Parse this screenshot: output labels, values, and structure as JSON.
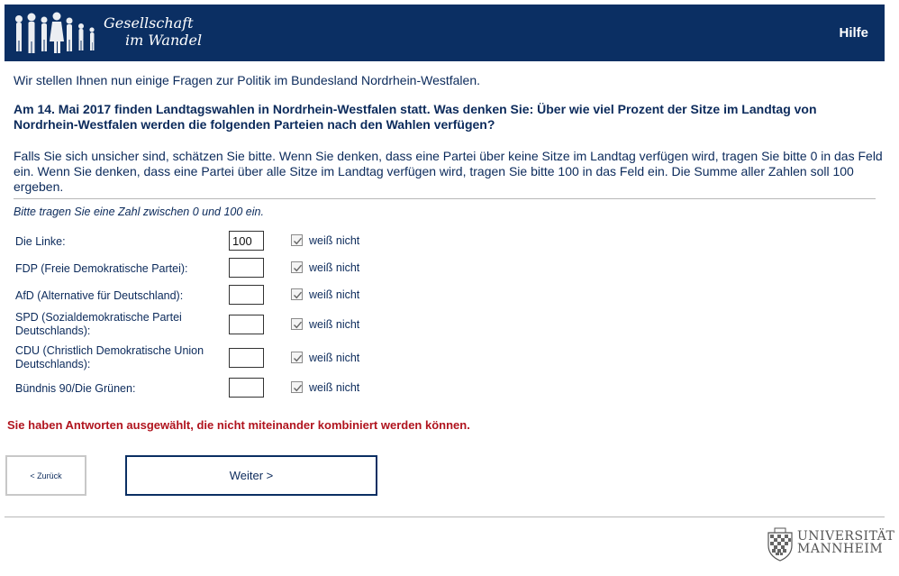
{
  "header": {
    "logo_line1": "Gesellschaft",
    "logo_line2": "im Wandel",
    "help_label": "Hilfe",
    "background_color": "#0b2f63"
  },
  "intro": "Wir stellen Ihnen nun einige Fragen zur Politik im Bundesland Nordrhein-Westfalen.",
  "question": "Am 14. Mai 2017 finden Landtagswahlen in Nordrhein-Westfalen statt. Was denken Sie: Über wie viel Prozent der Sitze im Landtag von Nordrhein-Westfalen werden die folgenden Parteien nach den Wahlen verfügen?",
  "note": "Falls Sie sich unsicher sind, schätzen Sie bitte. Wenn Sie denken, dass eine Partei über keine Sitze im Landtag verfügen wird, tragen Sie bitte 0 in das Feld ein. Wenn Sie denken, dass eine Partei über alle Sitze im Landtag verfügen wird, tragen Sie bitte 100 in das Feld ein. Die Summe aller Zahlen soll 100 ergeben.",
  "hint": "Bitte tragen Sie eine Zahl zwischen 0 und 100 ein.",
  "rows": [
    {
      "label": "Die Linke:",
      "value": "100",
      "dont_know_label": "weiß nicht",
      "dont_know_checked": true
    },
    {
      "label": "FDP (Freie Demokratische Partei):",
      "value": "",
      "dont_know_label": "weiß nicht",
      "dont_know_checked": true
    },
    {
      "label": "AfD (Alternative für Deutschland):",
      "value": "",
      "dont_know_label": "weiß nicht",
      "dont_know_checked": true
    },
    {
      "label": "SPD (Sozialdemokratische Partei Deutschlands):",
      "value": "",
      "dont_know_label": "weiß nicht",
      "dont_know_checked": true
    },
    {
      "label": "CDU (Christlich Demokratische Union Deutschlands):",
      "value": "",
      "dont_know_label": "weiß nicht",
      "dont_know_checked": true
    },
    {
      "label": "Bündnis 90/Die Grünen:",
      "value": "",
      "dont_know_label": "weiß nicht",
      "dont_know_checked": true
    }
  ],
  "error": "Sie haben Antworten ausgewählt, die nicht miteinander kombiniert werden können.",
  "error_color": "#b0141e",
  "nav": {
    "back_label": "< Zurück",
    "next_label": "Weiter >"
  },
  "footer": {
    "uni_line1": "UNIVERSITÄT",
    "uni_line2": "MANNHEIM"
  }
}
